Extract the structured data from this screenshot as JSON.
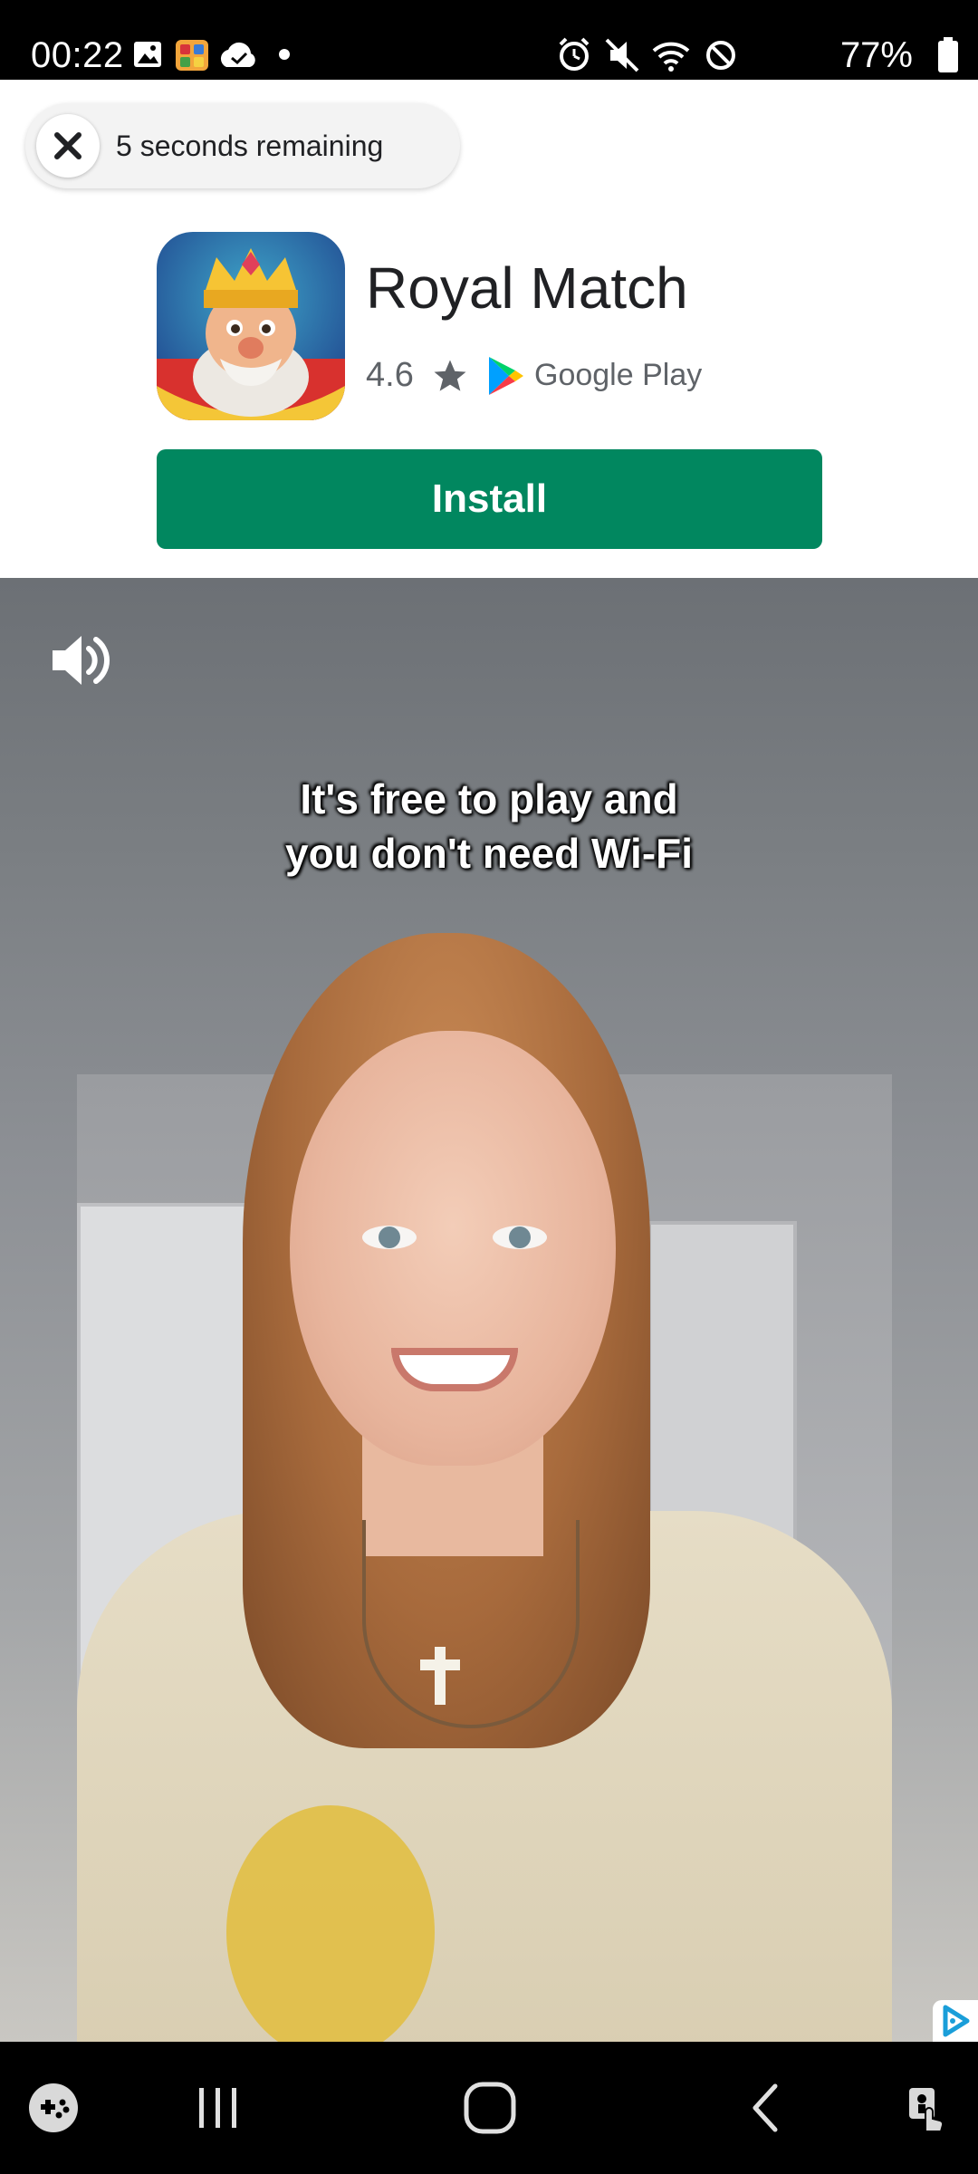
{
  "status_bar": {
    "time": "00:22",
    "battery": "77%",
    "left_icons": [
      "image-icon",
      "game-app-icon",
      "cloud-check-icon",
      "dot-icon"
    ],
    "right_icons": [
      "alarm-icon",
      "mute-icon",
      "wifi-icon",
      "do-not-disturb-icon",
      "battery-icon"
    ]
  },
  "ad": {
    "countdown_text": "5 seconds remaining",
    "app_name": "Royal Match",
    "rating": "4.6",
    "store_name": "Google Play",
    "install_label": "Install",
    "install_color": "#01875f"
  },
  "video": {
    "subtitle_line1": "It's free to play and",
    "subtitle_line2": "you don't need Wi-Fi",
    "sound_icon": "speaker-on-icon",
    "adchoices_icon": "adchoices-icon"
  },
  "nav_bar": {
    "buttons": [
      "game-launcher-icon",
      "recent-apps-icon",
      "home-icon",
      "back-icon",
      "accessibility-icon"
    ]
  }
}
